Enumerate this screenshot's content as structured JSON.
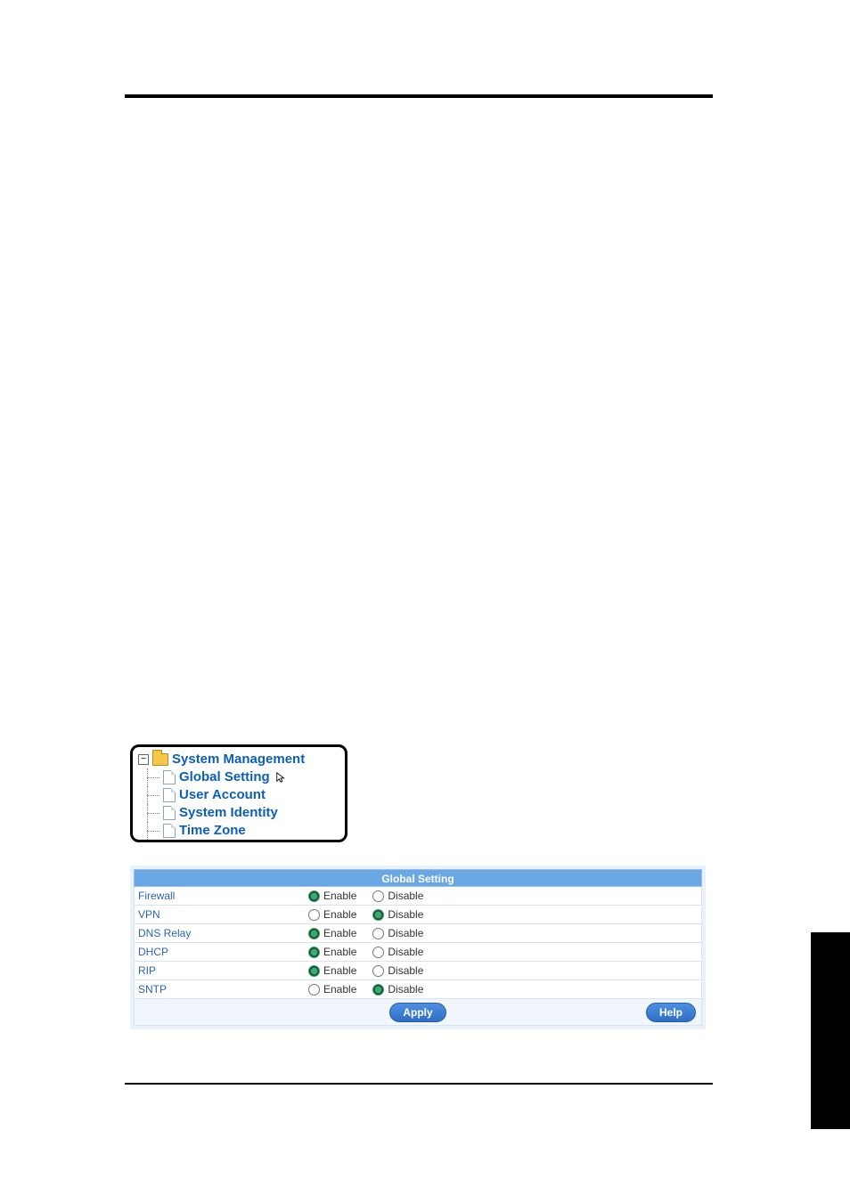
{
  "tree": {
    "root_label": "System Management",
    "items": [
      {
        "label": "Global Setting",
        "has_cursor": true
      },
      {
        "label": "User Account",
        "has_cursor": false
      },
      {
        "label": "System Identity",
        "has_cursor": false
      },
      {
        "label": "Time Zone",
        "has_cursor": false
      }
    ]
  },
  "global_setting": {
    "header": "Global Setting",
    "labels": {
      "enable": "Enable",
      "disable": "Disable"
    },
    "rows": [
      {
        "name": "Firewall",
        "value": "enable"
      },
      {
        "name": "VPN",
        "value": "disable"
      },
      {
        "name": "DNS Relay",
        "value": "enable"
      },
      {
        "name": "DHCP",
        "value": "enable"
      },
      {
        "name": "RIP",
        "value": "enable"
      },
      {
        "name": "SNTP",
        "value": "disable"
      }
    ],
    "buttons": {
      "apply": "Apply",
      "help": "Help"
    }
  }
}
